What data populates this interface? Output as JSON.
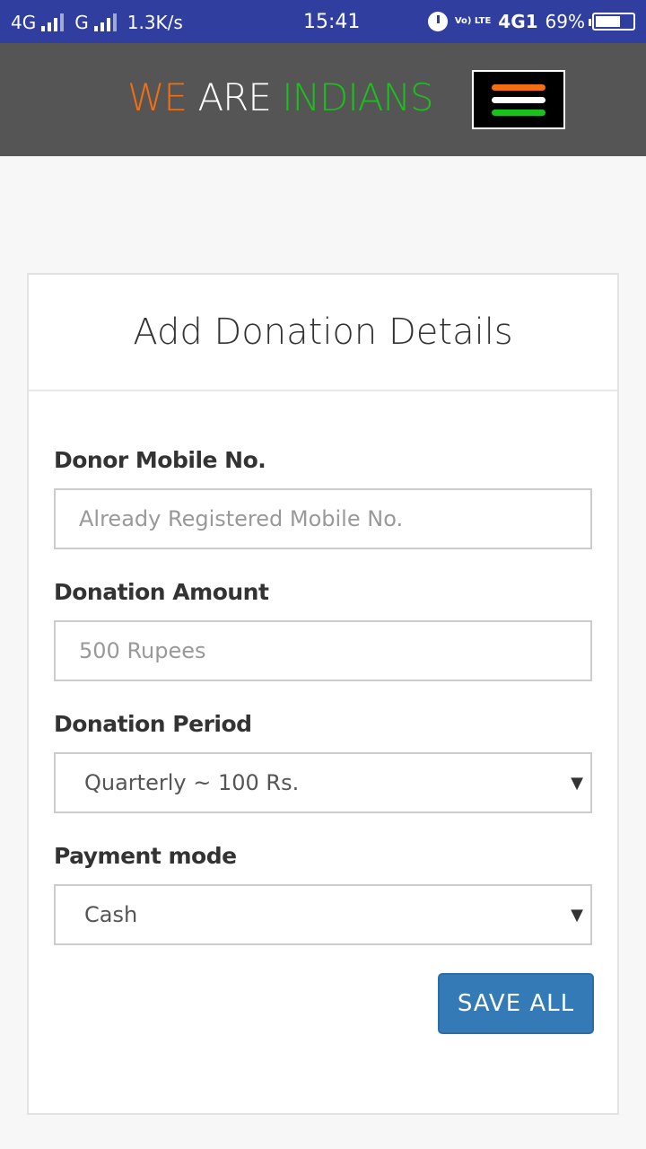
{
  "status_bar": {
    "network1": "4G",
    "network2": "G",
    "speed": "1.3K/s",
    "clock": "15:41",
    "volte": "Vo) LTE",
    "network3": "4G1",
    "battery": "69%"
  },
  "header": {
    "brand_part1": "WE",
    "brand_part2": "ARE",
    "brand_part3": "INDIANS"
  },
  "form": {
    "title": "Add Donation Details",
    "mobile_label": "Donor Mobile No.",
    "mobile_placeholder": "Already Registered Mobile No.",
    "amount_label": "Donation Amount",
    "amount_placeholder": "500 Rupees",
    "period_label": "Donation Period",
    "period_value": "Quarterly ~ 100 Rs.",
    "payment_label": "Payment mode",
    "payment_value": "Cash",
    "save_label": "SAVE ALL"
  },
  "colors": {
    "status_bar": "#303f9f",
    "header_bg": "#555555",
    "saffron": "#f36e10",
    "white": "#ffffff",
    "green": "#1cc01c",
    "button": "#337ab7"
  },
  "icons": {
    "alarm": "alarm-icon",
    "signal": "signal-icon",
    "battery": "battery-icon",
    "menu": "hamburger-menu-icon",
    "dropdown": "dropdown-caret-icon"
  }
}
